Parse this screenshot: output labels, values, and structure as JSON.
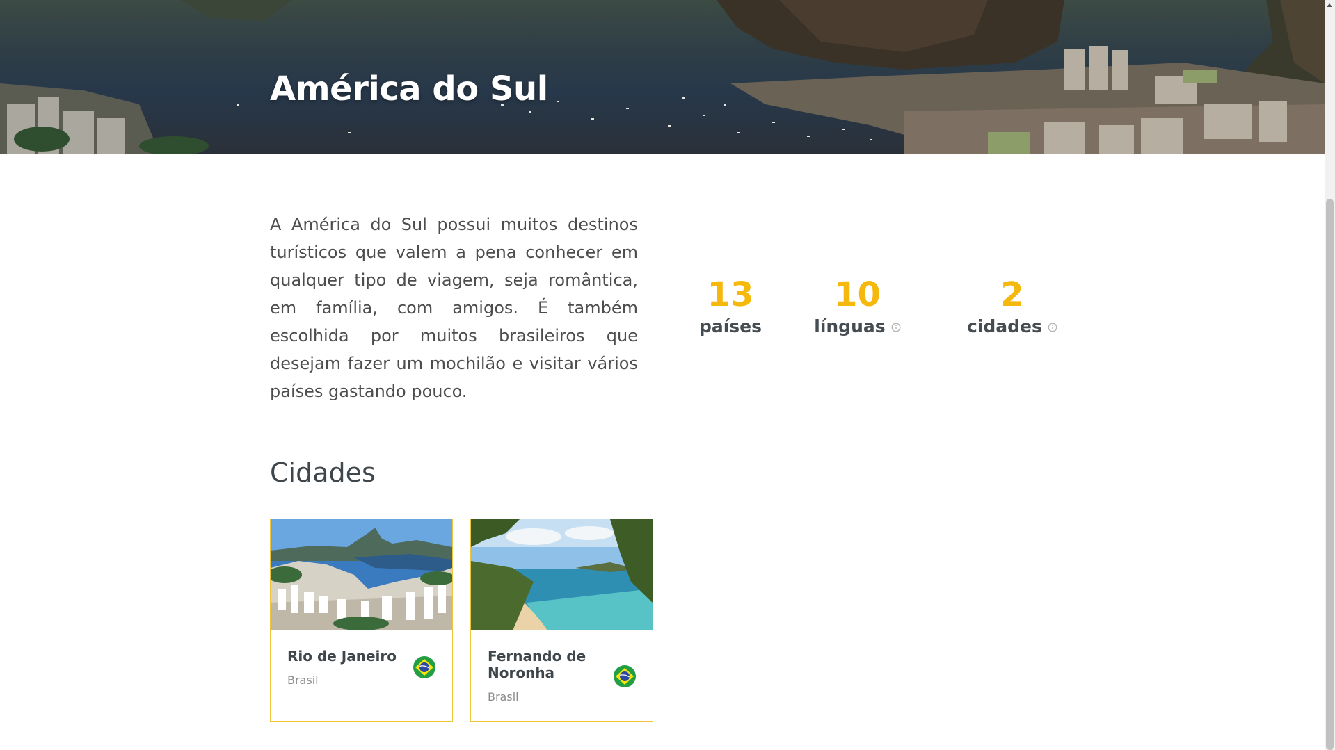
{
  "hero": {
    "title": "América do Sul"
  },
  "description": "A América do Sul possui muitos destinos turísticos que valem a pena conhecer em qualquer tipo de viagem, seja romântica, em família, com amigos. É também escolhida por muitos brasileiros que desejam fazer um mochilão e visitar vários países gastando pouco.",
  "stats": [
    {
      "number": "13",
      "label": "países"
    },
    {
      "number": "10",
      "label": "línguas",
      "icon": "info-icon"
    },
    {
      "number": "2",
      "label": "cidades",
      "icon": "info-icon"
    }
  ],
  "cities_section": {
    "title": "Cidades",
    "cards": [
      {
        "name": "Rio de Janeiro",
        "country": "Brasil",
        "flag_icon": "brazil-flag-icon"
      },
      {
        "name": "Fernando de Noronha",
        "country": "Brasil",
        "flag_icon": "brazil-flag-icon"
      }
    ]
  },
  "colors": {
    "accent": "#f5b80c",
    "card_border": "#f0c53a",
    "text_dark": "#3f474c"
  }
}
